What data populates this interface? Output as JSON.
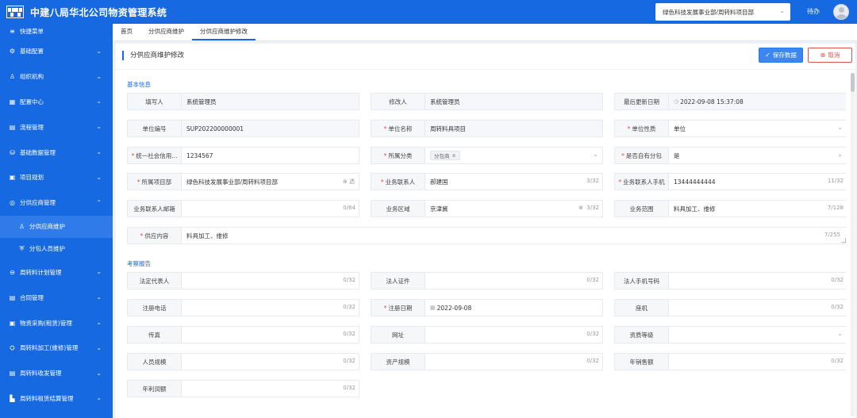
{
  "header": {
    "app_title": "中建八局华北公司物资管理系统",
    "org_select": "绿色科技发展事业部/周转料项目部",
    "todo": "待办"
  },
  "sidebar": {
    "quick_menu": "快捷菜单",
    "items": [
      {
        "label": "基础配置",
        "icon": "gear-icon",
        "glyph": "⚙"
      },
      {
        "label": "组织机构",
        "icon": "org-icon",
        "glyph": "♙"
      },
      {
        "label": "配置中心",
        "icon": "grid-icon",
        "glyph": "▦"
      },
      {
        "label": "流程管理",
        "icon": "flow-icon",
        "glyph": "▤"
      },
      {
        "label": "基础数据管理",
        "icon": "data-icon",
        "glyph": "⛁"
      },
      {
        "label": "项目规划",
        "icon": "plan-icon",
        "glyph": "▣"
      },
      {
        "label": "分供应商管理",
        "icon": "supplier-icon",
        "glyph": "◎"
      },
      {
        "label": "分供应商维护",
        "icon": "user-icon",
        "glyph": "♙"
      },
      {
        "label": "分包人员维护",
        "icon": "shield-icon",
        "glyph": "⛨"
      },
      {
        "label": "周转料计划管理",
        "icon": "link-icon",
        "glyph": "⊖"
      },
      {
        "label": "合同管理",
        "icon": "contract-icon",
        "glyph": "▤"
      },
      {
        "label": "物资采购(租赁)管理",
        "icon": "cart-icon",
        "glyph": "▣"
      },
      {
        "label": "周转料加工(维修)管理",
        "icon": "tools-icon",
        "glyph": "⛭"
      },
      {
        "label": "周转料收发管理",
        "icon": "doc-icon",
        "glyph": "▤"
      },
      {
        "label": "周转料租赁结算管理",
        "icon": "settle-icon",
        "glyph": "▙"
      }
    ]
  },
  "tabs": [
    "首页",
    "分供应商维护",
    "分供应商维护修改"
  ],
  "page": {
    "title": "分供应商维护修改",
    "save_label": "保存数据",
    "cancel_label": "取消"
  },
  "sections": {
    "basic": "基本信息",
    "inspect": "考察报告"
  },
  "basic_fields": [
    {
      "label": "填写人",
      "value": "系统管理员"
    },
    {
      "label": "修改人",
      "value": "系统管理员"
    },
    {
      "label": "最后更新日期",
      "value": "2022-09-08 15:37:08"
    },
    {
      "label": "单位编号",
      "value": "SUP202200000001"
    },
    {
      "label": "单位名称",
      "value": "周转料具项目"
    },
    {
      "label": "单位性质",
      "value": "单位"
    },
    {
      "label": "统一社会信用...",
      "value": "1234567"
    },
    {
      "label": "所属分类",
      "value": "分包商"
    },
    {
      "label": "是否自有分包",
      "value": "是"
    },
    {
      "label": "所属项目部",
      "value": "绿色科技发展事业部/周转料项目部",
      "suffix": "⊗ 选"
    },
    {
      "label": "业务联系人",
      "value": "郝建国",
      "count": "3/32"
    },
    {
      "label": "业务联系人手机",
      "value": "13444444444",
      "count": "11/32"
    },
    {
      "label": "业务联系人邮箱",
      "value": "",
      "count": "0/64"
    },
    {
      "label": "业务区域",
      "value": "京津冀",
      "count": "3/32"
    },
    {
      "label": "业务范围",
      "value": "料具加工、维修",
      "count": "7/128"
    },
    {
      "label": "供应内容",
      "value": "料具加工、维修",
      "count": "7/255"
    }
  ],
  "inspect_fields": [
    {
      "label": "法定代表人",
      "value": "",
      "count": "0/32"
    },
    {
      "label": "法人证件",
      "value": "",
      "count": "0/32"
    },
    {
      "label": "法人手机号码",
      "value": "",
      "count": "0/32"
    },
    {
      "label": "注册电话",
      "value": "",
      "count": "0/32"
    },
    {
      "label": "注册日期",
      "value": "2022-09-08"
    },
    {
      "label": "座机",
      "value": "",
      "count": "0/32"
    },
    {
      "label": "传真",
      "value": "",
      "count": "0/32"
    },
    {
      "label": "网址",
      "value": "",
      "count": "0/32"
    },
    {
      "label": "资质等级",
      "value": ""
    },
    {
      "label": "人员规模",
      "value": "",
      "count": "0/32"
    },
    {
      "label": "资产规模",
      "value": "",
      "count": "0/32"
    },
    {
      "label": "年销售额",
      "value": "",
      "count": "0/32"
    },
    {
      "label": "年利润额",
      "value": "",
      "count": "0/32"
    }
  ]
}
